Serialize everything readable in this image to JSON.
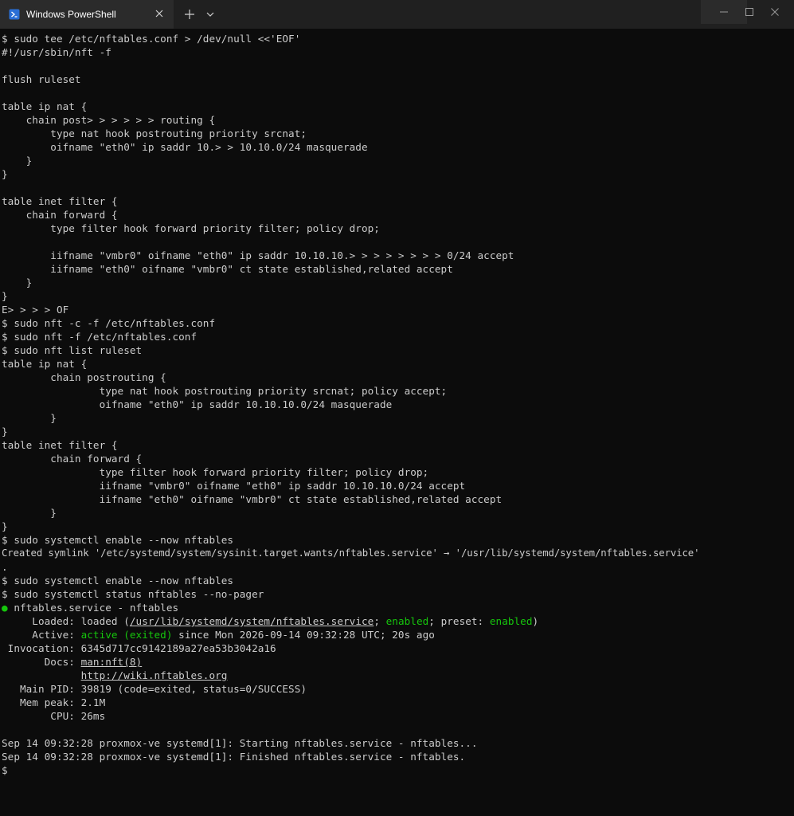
{
  "window": {
    "tab_title": "Windows PowerShell",
    "icons": {
      "tab": "powershell-icon",
      "close": "close-icon",
      "new_tab": "plus-icon",
      "dropdown": "chevron-down-icon",
      "minimize": "minimize-icon",
      "maximize": "maximize-icon",
      "window_close": "close-icon"
    }
  },
  "colors": {
    "background": "#0c0c0c",
    "text": "#cccccc",
    "green": "#16c60c",
    "titlebar": "#202020",
    "tab": "#2b2b2b"
  },
  "terminal": {
    "lines": [
      "$ sudo tee /etc/nftables.conf > /dev/null <<'EOF'",
      "#!/usr/sbin/nft -f",
      "",
      "flush ruleset",
      "",
      "table ip nat {",
      "    chain post> > > > > > routing {",
      "        type nat hook postrouting priority srcnat;",
      "        oifname \"eth0\" ip saddr 10.> > 10.10.0/24 masquerade",
      "    }",
      "}",
      "",
      "table inet filter {",
      "    chain forward {",
      "        type filter hook forward priority filter; policy drop;",
      "",
      "        iifname \"vmbr0\" oifname \"eth0\" ip saddr 10.10.10.> > > > > > > > 0/24 accept",
      "        iifname \"eth0\" oifname \"vmbr0\" ct state established,related accept",
      "    }",
      "}",
      "E> > > > OF",
      "$ sudo nft -c -f /etc/nftables.conf",
      "$ sudo nft -f /etc/nftables.conf",
      "$ sudo nft list ruleset",
      "table ip nat {",
      "        chain postrouting {",
      "                type nat hook postrouting priority srcnat; policy accept;",
      "                oifname \"eth0\" ip saddr 10.10.10.0/24 masquerade",
      "        }",
      "}",
      "table inet filter {",
      "        chain forward {",
      "                type filter hook forward priority filter; policy drop;",
      "                iifname \"vmbr0\" oifname \"eth0\" ip saddr 10.10.10.0/24 accept",
      "                iifname \"eth0\" oifname \"vmbr0\" ct state established,related accept",
      "        }",
      "}",
      "$ sudo systemctl enable --now nftables",
      "Created symlink '/etc/systemd/system/sysinit.target.wants/nftables.service' → '/usr/lib/systemd/system/nftables.service'",
      ".",
      "$ sudo systemctl enable --now nftables",
      "$ sudo systemctl status nftables --no-pager"
    ],
    "status": {
      "bullet": "●",
      "header": " nftables.service - nftables",
      "loaded_label": "     Loaded: ",
      "loaded_pre": "loaded (",
      "loaded_path": "/usr/lib/systemd/system/nftables.service",
      "loaded_sep1": "; ",
      "loaded_enabled": "enabled",
      "loaded_sep2": "; preset: ",
      "loaded_preset": "enabled",
      "loaded_post": ")",
      "active_label": "     Active: ",
      "active_state": "active (exited)",
      "active_rest": " since Mon 2026-09-14 09:32:28 UTC; 20s ago",
      "invocation": " Invocation: 6345d717cc9142189a27ea53b3042a16",
      "docs_label": "       Docs: ",
      "docs_1": "man:nft(8)",
      "docs_indent": "             ",
      "docs_2": "http://wiki.nftables.org",
      "main_pid": "   Main PID: 39819 (code=exited, status=0/SUCCESS)",
      "mem_peak": "   Mem peak: 2.1M",
      "cpu": "        CPU: 26ms"
    },
    "log_lines": [
      "",
      "Sep 14 09:32:28 proxmox-ve systemd[1]: Starting nftables.service - nftables...",
      "Sep 14 09:32:28 proxmox-ve systemd[1]: Finished nftables.service - nftables.",
      "$"
    ]
  }
}
